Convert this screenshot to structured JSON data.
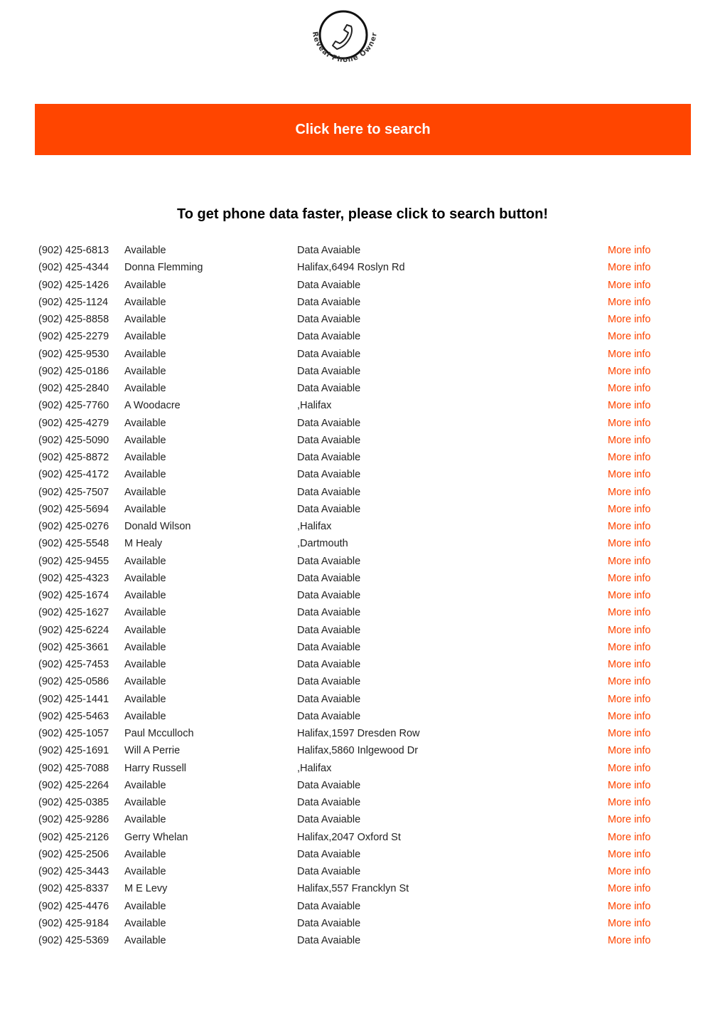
{
  "brand": {
    "logo_text": "Reveal Phone Owner",
    "logo_icon": "phone-handset-icon",
    "accent_color": "#ff4500"
  },
  "banner": {
    "label": "Click here to search"
  },
  "headline": "To get phone data faster, please click to search button!",
  "more_info_label": "More info",
  "listings": [
    {
      "phone": "(902) 425-6813",
      "name": "Available",
      "address": "Data Avaiable"
    },
    {
      "phone": "(902) 425-4344",
      "name": "Donna Flemming",
      "address": "Halifax,6494 Roslyn Rd"
    },
    {
      "phone": "(902) 425-1426",
      "name": "Available",
      "address": "Data Avaiable"
    },
    {
      "phone": "(902) 425-1124",
      "name": "Available",
      "address": "Data Avaiable"
    },
    {
      "phone": "(902) 425-8858",
      "name": "Available",
      "address": "Data Avaiable"
    },
    {
      "phone": "(902) 425-2279",
      "name": "Available",
      "address": "Data Avaiable"
    },
    {
      "phone": "(902) 425-9530",
      "name": "Available",
      "address": "Data Avaiable"
    },
    {
      "phone": "(902) 425-0186",
      "name": "Available",
      "address": "Data Avaiable"
    },
    {
      "phone": "(902) 425-2840",
      "name": "Available",
      "address": "Data Avaiable"
    },
    {
      "phone": "(902) 425-7760",
      "name": "A Woodacre",
      "address": ",Halifax"
    },
    {
      "phone": "(902) 425-4279",
      "name": "Available",
      "address": "Data Avaiable"
    },
    {
      "phone": "(902) 425-5090",
      "name": "Available",
      "address": "Data Avaiable"
    },
    {
      "phone": "(902) 425-8872",
      "name": "Available",
      "address": "Data Avaiable"
    },
    {
      "phone": "(902) 425-4172",
      "name": "Available",
      "address": "Data Avaiable"
    },
    {
      "phone": "(902) 425-7507",
      "name": "Available",
      "address": "Data Avaiable"
    },
    {
      "phone": "(902) 425-5694",
      "name": "Available",
      "address": "Data Avaiable"
    },
    {
      "phone": "(902) 425-0276",
      "name": "Donald Wilson",
      "address": ",Halifax"
    },
    {
      "phone": "(902) 425-5548",
      "name": "M Healy",
      "address": ",Dartmouth"
    },
    {
      "phone": "(902) 425-9455",
      "name": "Available",
      "address": "Data Avaiable"
    },
    {
      "phone": "(902) 425-4323",
      "name": "Available",
      "address": "Data Avaiable"
    },
    {
      "phone": "(902) 425-1674",
      "name": "Available",
      "address": "Data Avaiable"
    },
    {
      "phone": "(902) 425-1627",
      "name": "Available",
      "address": "Data Avaiable"
    },
    {
      "phone": "(902) 425-6224",
      "name": "Available",
      "address": "Data Avaiable"
    },
    {
      "phone": "(902) 425-3661",
      "name": "Available",
      "address": "Data Avaiable"
    },
    {
      "phone": "(902) 425-7453",
      "name": "Available",
      "address": "Data Avaiable"
    },
    {
      "phone": "(902) 425-0586",
      "name": "Available",
      "address": "Data Avaiable"
    },
    {
      "phone": "(902) 425-1441",
      "name": "Available",
      "address": "Data Avaiable"
    },
    {
      "phone": "(902) 425-5463",
      "name": "Available",
      "address": "Data Avaiable"
    },
    {
      "phone": "(902) 425-1057",
      "name": "Paul Mcculloch",
      "address": "Halifax,1597 Dresden Row"
    },
    {
      "phone": "(902) 425-1691",
      "name": "Will A Perrie",
      "address": "Halifax,5860 Inlgewood Dr"
    },
    {
      "phone": "(902) 425-7088",
      "name": "Harry Russell",
      "address": ",Halifax"
    },
    {
      "phone": "(902) 425-2264",
      "name": "Available",
      "address": "Data Avaiable"
    },
    {
      "phone": "(902) 425-0385",
      "name": "Available",
      "address": "Data Avaiable"
    },
    {
      "phone": "(902) 425-9286",
      "name": "Available",
      "address": "Data Avaiable"
    },
    {
      "phone": "(902) 425-2126",
      "name": "Gerry Whelan",
      "address": "Halifax,2047 Oxford St"
    },
    {
      "phone": "(902) 425-2506",
      "name": "Available",
      "address": "Data Avaiable"
    },
    {
      "phone": "(902) 425-3443",
      "name": "Available",
      "address": "Data Avaiable"
    },
    {
      "phone": "(902) 425-8337",
      "name": "M E Levy",
      "address": "Halifax,557 Francklyn St"
    },
    {
      "phone": "(902) 425-4476",
      "name": "Available",
      "address": "Data Avaiable"
    },
    {
      "phone": "(902) 425-9184",
      "name": "Available",
      "address": "Data Avaiable"
    },
    {
      "phone": "(902) 425-5369",
      "name": "Available",
      "address": "Data Avaiable"
    }
  ]
}
